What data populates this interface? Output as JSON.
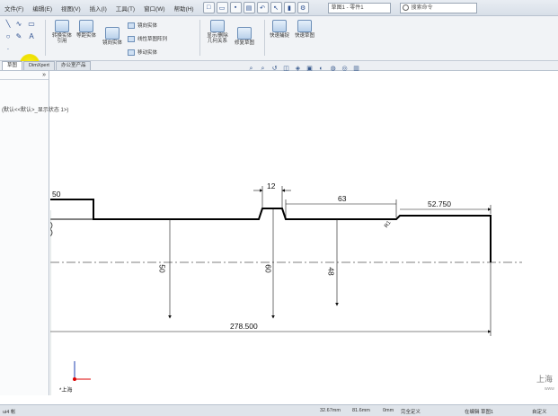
{
  "menu": {
    "items": [
      "文件(F)",
      "编辑(E)",
      "视图(V)",
      "插入(I)",
      "工具(T)",
      "窗口(W)",
      "帮助(H)"
    ],
    "document_name": "草图1 - 零件1",
    "search_placeholder": "搜索命令"
  },
  "ribbon": {
    "buttons": {
      "convert_entities": "转换实体引用",
      "offset_entities": "等距实体",
      "mirror_entities": "镜向实体",
      "display_delete": "显示/删除几何关系",
      "repair_sketch": "修复草图",
      "quick_snaps": "快速捕捉",
      "rapid_sketch": "快速草图"
    },
    "rows": {
      "linear_pattern": "线性草图阵列",
      "move_entities": "移动实体",
      "mirror": "镜向实体"
    }
  },
  "tabs": [
    "草图",
    "DimXpert",
    "办公室产品"
  ],
  "left_panel": {
    "collapse": "»",
    "tree_item": "(默认<<默认>_显示状态 1>)"
  },
  "drawing": {
    "dimensions": {
      "d_50_top": "50",
      "d_12": "12",
      "d_63": "63",
      "d_52750": "52.750",
      "d_r": "R1",
      "d_50_v": "50",
      "d_60_v": "60",
      "d_48_v": "48",
      "d_278500": "278.500"
    },
    "axis_label": "上海",
    "origin_label": "*上海"
  },
  "statusbar": {
    "left": "ui4 帐",
    "x_coord": "32.67mm",
    "y_coord": "81.6mm",
    "z_coord": "0mm",
    "status": "完全定义",
    "mode": "在编辑 草图1",
    "custom": "自定义"
  },
  "watermark": "上海",
  "watermark2": "www"
}
